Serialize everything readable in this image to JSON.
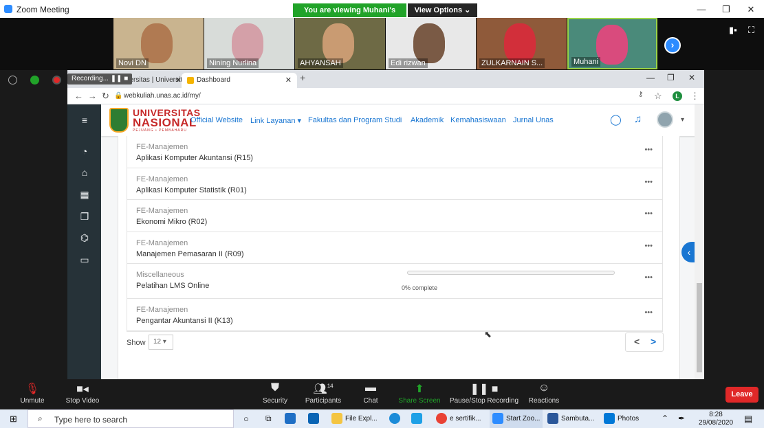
{
  "zoom": {
    "window_title": "Zoom Meeting",
    "viewing_banner": "You are viewing Muhani's screen",
    "view_options": "View Options ⌄",
    "participants": [
      {
        "name": "Novi DN",
        "bg": "#c9b48f",
        "face": "#b07a52"
      },
      {
        "name": "Nining Nurlina",
        "bg": "#d8dcd9",
        "face": "#d4a0a8"
      },
      {
        "name": "AHYANSAH",
        "bg": "#6e6a45",
        "face": "#c99b72"
      },
      {
        "name": "Edi rizwan",
        "bg": "#e8e8e8",
        "face": "#7a5a45"
      },
      {
        "name": "ZULKARNAIN S...",
        "bg": "#8f5a3a",
        "face": "#d22f3a"
      },
      {
        "name": "Muhani",
        "bg": "#4a8a7a",
        "face": "#d94b7d"
      }
    ],
    "recording_label": "Recording...",
    "controls": {
      "unmute": "Unmute",
      "stop_video": "Stop Video",
      "security": "Security",
      "participants": "Participants",
      "participant_count": "14",
      "chat": "Chat",
      "share_screen": "Share Screen",
      "pause_recording": "Pause/Stop Recording",
      "reactions": "Reactions",
      "leave": "Leave"
    },
    "colors": {
      "accent": "#2d8cff",
      "share_green": "#21a329",
      "leave_red": "#e02828"
    }
  },
  "browser": {
    "tab_inactive": "Pimpinan Universitas | Universita",
    "tab_active": "Dashboard",
    "url": "webkuliah.unas.ac.id/my/",
    "profile_initial": "L"
  },
  "site": {
    "logo_line1": "UNIVERSITAS",
    "logo_line2": "NASIONAL",
    "logo_line3": "PEJUANG • PEMBAHARU",
    "nav": [
      "Official Website",
      "Link Layanan ▾",
      "Fakultas dan Program Studi",
      "Akademik",
      "Kemahasiswaan",
      "Jurnal Unas"
    ],
    "courses": [
      {
        "category": "FE-Manajemen",
        "title": "Aplikasi Komputer Akuntansi (R15)"
      },
      {
        "category": "FE-Manajemen",
        "title": "Aplikasi Komputer Statistik (R01)"
      },
      {
        "category": "FE-Manajemen",
        "title": "Ekonomi Mikro (R02)"
      },
      {
        "category": "FE-Manajemen",
        "title": "Manajemen Pemasaran II (R09)"
      },
      {
        "category": "Miscellaneous",
        "title": "Pelatihan LMS Online",
        "progress_text": "0% complete",
        "progress": 0
      },
      {
        "category": "FE-Manajemen",
        "title": "Pengantar Akuntansi II (K13)"
      }
    ],
    "more_glyph": "•••",
    "show_label": "Show",
    "show_value": "12 ▾",
    "prev_glyph": "<",
    "next_glyph": ">"
  },
  "taskbar": {
    "search_placeholder": "Type here to search",
    "apps": [
      {
        "label": "File Expl...",
        "color": "#f4c542"
      },
      {
        "label": "e sertifik...",
        "color": "#e94235"
      },
      {
        "label": "Start Zoo...",
        "color": "#2d8cff"
      },
      {
        "label": "Sambuta...",
        "color": "#2b579a"
      },
      {
        "label": "Photos",
        "color": "#0078d7"
      }
    ],
    "time": "8:28",
    "date": "29/08/2020"
  }
}
